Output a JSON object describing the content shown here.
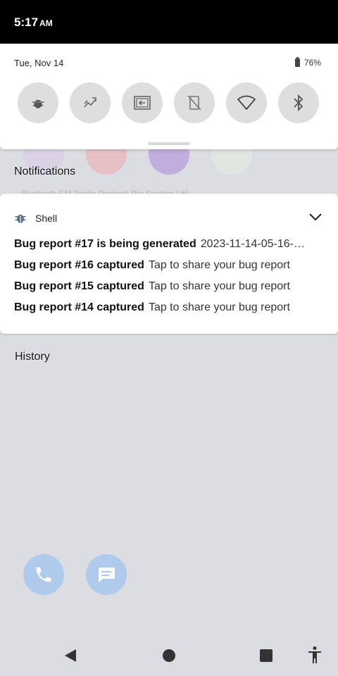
{
  "status_bar": {
    "time": "5:17",
    "ampm": "AM"
  },
  "quick_settings": {
    "date": "Tue, Nov 14",
    "battery": "76%",
    "tiles": [
      "bug-report-icon",
      "sync-icon",
      "screen-cast-icon",
      "rotation-off-icon",
      "wifi-icon",
      "bluetooth-icon"
    ]
  },
  "notifications": {
    "header": "Notifications",
    "card": {
      "app_name": "Shell",
      "items": [
        {
          "title": "Bug report #17 is being generated",
          "text": "2023-11-14-05-16-…"
        },
        {
          "title": "Bug report #16 captured",
          "text": "Tap to share your bug report"
        },
        {
          "title": "Bug report #15 captured",
          "text": "Tap to share your bug report"
        },
        {
          "title": "Bug report #14 captured",
          "text": "Tap to share your bug report"
        }
      ]
    }
  },
  "history_label": "History",
  "background": {
    "app_labels": "Bluetooth    FM Radio    Podcast Pla    System Util"
  },
  "colors": {
    "accent": "#4a90e2",
    "tile_bg": "#dedede"
  }
}
